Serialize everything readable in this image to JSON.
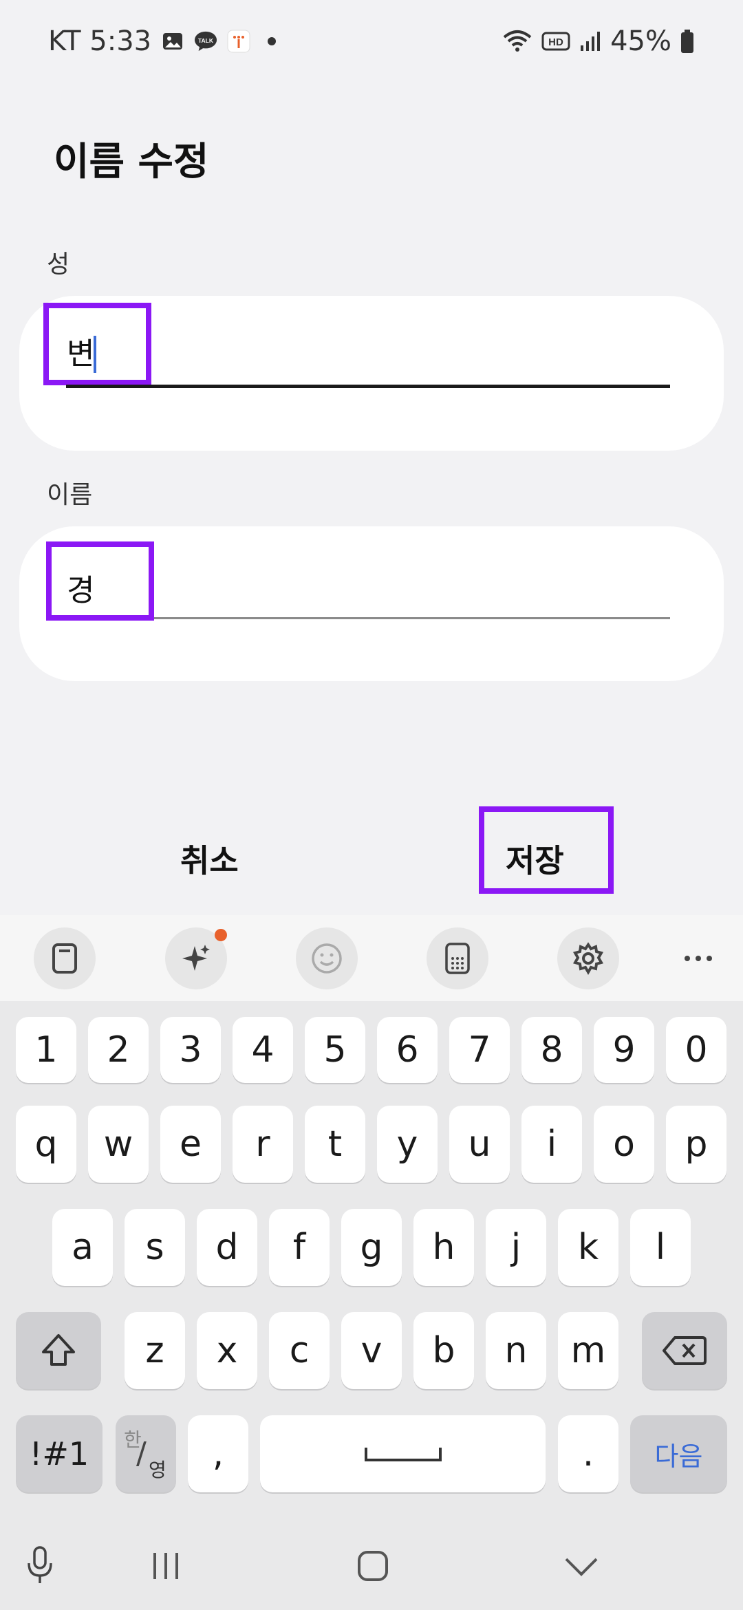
{
  "status_bar": {
    "carrier_time": "KT 5:33",
    "battery": "45%",
    "talk_label": "TALK",
    "hd_label": "HD"
  },
  "dialog": {
    "title": "이름 수정",
    "last_name_label": "성",
    "last_name_value": "변",
    "first_name_label": "이름",
    "first_name_value": "경",
    "cancel_label": "취소",
    "save_label": "저장"
  },
  "toolbar": {
    "items": [
      "clipboard-icon",
      "ai-sparkle-icon",
      "emoji-icon",
      "keypad-icon",
      "settings-icon",
      "more-icon"
    ],
    "notification_color": "#e8612c"
  },
  "keyboard": {
    "row_numbers": [
      "1",
      "2",
      "3",
      "4",
      "5",
      "6",
      "7",
      "8",
      "9",
      "0"
    ],
    "row_1": [
      "q",
      "w",
      "e",
      "r",
      "t",
      "y",
      "u",
      "i",
      "o",
      "p"
    ],
    "row_2": [
      "a",
      "s",
      "d",
      "f",
      "g",
      "h",
      "j",
      "k",
      "l"
    ],
    "row_3": [
      "z",
      "x",
      "c",
      "v",
      "b",
      "n",
      "m"
    ],
    "symbols_label": "!#1",
    "lang_top": "한",
    "lang_bottom": "영",
    "comma": ",",
    "period": ".",
    "enter_label": "다음"
  },
  "colors": {
    "highlight": "#8b18f5",
    "cursor": "#3a6bd6",
    "enter_text": "#3a6bd6"
  }
}
